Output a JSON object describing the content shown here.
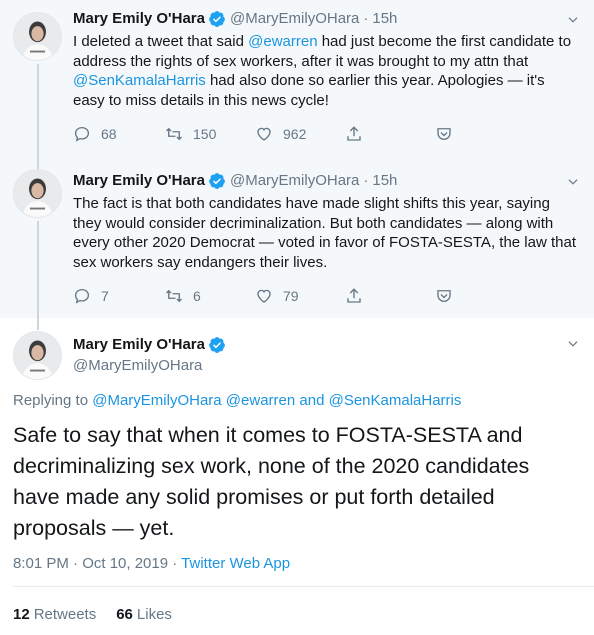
{
  "author": {
    "name": "Mary Emily O'Hara",
    "handle": "@MaryEmilyOHara"
  },
  "tweets": [
    {
      "time": "15h",
      "text_parts": [
        "I deleted a tweet that said ",
        "@ewarren",
        " had just become the first candidate to address the rights of sex workers, after it was brought to my attn that ",
        "@SenKamalaHarris",
        " had also done so earlier this year. Apologies — it's easy to miss details in this news cycle!"
      ],
      "replies": "68",
      "retweets": "150",
      "likes": "962"
    },
    {
      "time": "15h",
      "text": "The fact is that both candidates have made slight shifts this year, saying they would consider decriminalization. But both candidates — along with every other 2020 Democrat — voted in favor of FOSTA-SESTA, the law that sex workers say endangers their lives.",
      "replies": "7",
      "retweets": "6",
      "likes": "79"
    }
  ],
  "main_tweet": {
    "replying_label": "Replying to",
    "replying_to": [
      "@MaryEmilyOHara",
      "@ewarren",
      "@SenKamalaHarris"
    ],
    "replying_and": "and",
    "text": "Safe to say that when it comes to FOSTA-SESTA and decriminalizing sex work, none of the 2020 candidates have made any solid promises or put forth detailed proposals — yet.",
    "timestamp": "8:01 PM · Oct 10, 2019 ·",
    "client": "Twitter Web App",
    "retweets_count": "12",
    "retweets_label": "Retweets",
    "likes_count": "66",
    "likes_label": "Likes"
  },
  "ui": {
    "separator": "·"
  },
  "colors": {
    "accent": "#1b95e0",
    "verified": "#1da1f2",
    "secondary_text": "#657786",
    "thread_bg": "#f5f8fa"
  }
}
